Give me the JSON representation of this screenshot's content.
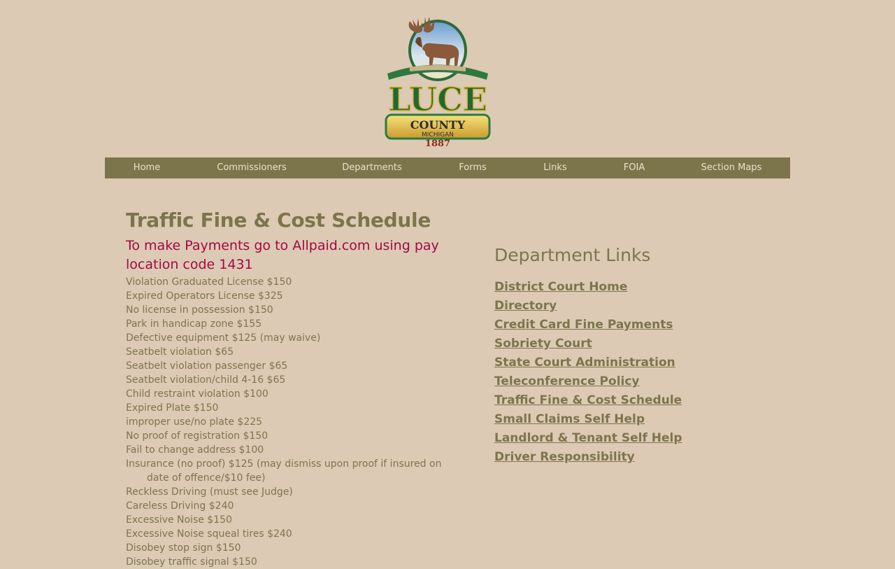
{
  "logo": {
    "name": "LUCE",
    "county": "COUNTY",
    "state": "MICHIGAN",
    "year": "1887"
  },
  "nav": [
    {
      "label": "Home"
    },
    {
      "label": "Commissioners"
    },
    {
      "label": "Departments"
    },
    {
      "label": "Forms"
    },
    {
      "label": "Links"
    },
    {
      "label": "FOIA"
    },
    {
      "label": "Section Maps"
    }
  ],
  "main": {
    "title": "Traffic Fine & Cost Schedule",
    "payment_note": "To make Payments go to Allpaid.com using pay location code 1431",
    "fines": [
      "Violation Graduated License $150",
      "Expired Operators License $325",
      "No license in possession $150",
      "Park in handicap zone $155",
      "Defective equipment $125 (may waive)",
      "Seatbelt violation $65",
      "Seatbelt violation passenger $65",
      "Seatbelt violation/child 4-16 $65",
      "Child restraint violation $100",
      "Expired Plate $150",
      "improper use/no plate $225",
      "No proof of registration $150",
      "Fail to change address $100",
      "Insurance (no proof) $125 (may dismiss upon proof if insured on date of offence/$10 fee)",
      "Reckless Driving (must see Judge)",
      "Careless Driving $240",
      "Excessive Noise $150",
      "Excessive Noise squeal tires $240",
      "Disobey stop sign $150",
      "Disobey traffic signal $150"
    ]
  },
  "side": {
    "title": "Department Links",
    "links": [
      "District Court Home",
      "Directory",
      "Credit Card Fine Payments",
      "Sobriety Court",
      "State Court Administration",
      "Teleconference Policy",
      "Traffic Fine & Cost Schedule",
      "Small Claims Self Help",
      "Landlord & Tenant Self Help",
      "Driver Responsibility"
    ]
  },
  "colors": {
    "background": "#dccab5",
    "nav": "#7c754c",
    "accent_red": "#a6073f",
    "text_olive": "#7c754c"
  }
}
